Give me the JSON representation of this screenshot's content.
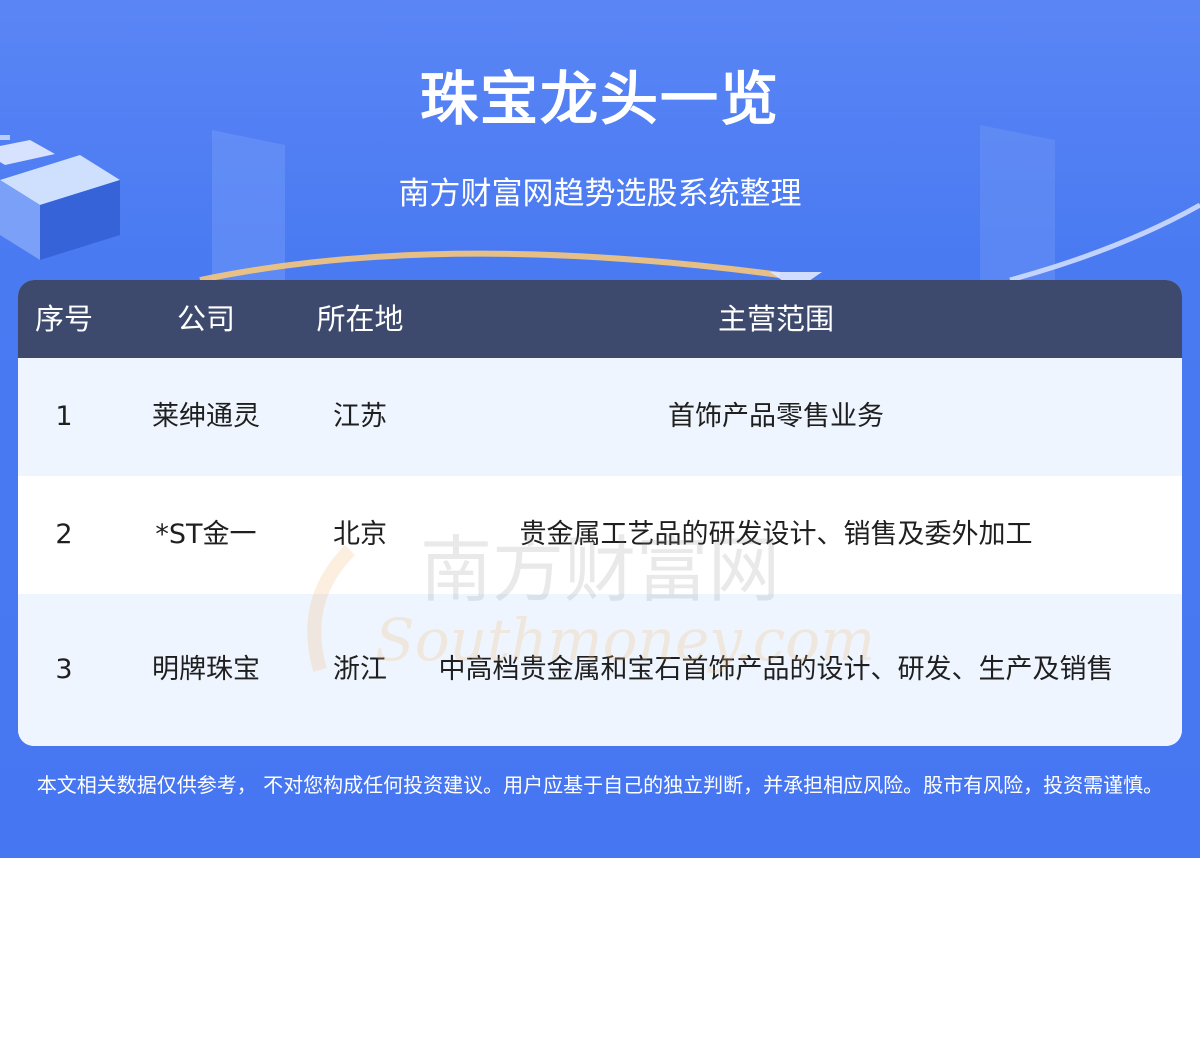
{
  "header": {
    "title": "珠宝龙头一览",
    "subtitle": "南方财富网趋势选股系统整理"
  },
  "table": {
    "columns": [
      "序号",
      "公司",
      "所在地",
      "主营范围"
    ],
    "rows": [
      {
        "index": "1",
        "company": "莱绅通灵",
        "location": "江苏",
        "business": "首饰产品零售业务"
      },
      {
        "index": "2",
        "company": "*ST金一",
        "location": "北京",
        "business": "贵金属工艺品的研发设计、销售及委外加工"
      },
      {
        "index": "3",
        "company": "明牌珠宝",
        "location": "浙江",
        "business": "中高档贵金属和宝石首饰产品的设计、研发、生产及销售"
      }
    ]
  },
  "watermark": {
    "text_cn": "南方财富网",
    "text_en": "Southmoney.com"
  },
  "footer": {
    "disclaimer": "本文相关数据仅供参考， 不对您构成任何投资建议。用户应基于自己的独立判断，并承担相应风险。股市有风险，投资需谨慎。"
  },
  "colors": {
    "banner": "#4676f1",
    "table_header": "#3d4a6e",
    "row_light": "#eef5fe",
    "row_white": "#ffffff"
  }
}
